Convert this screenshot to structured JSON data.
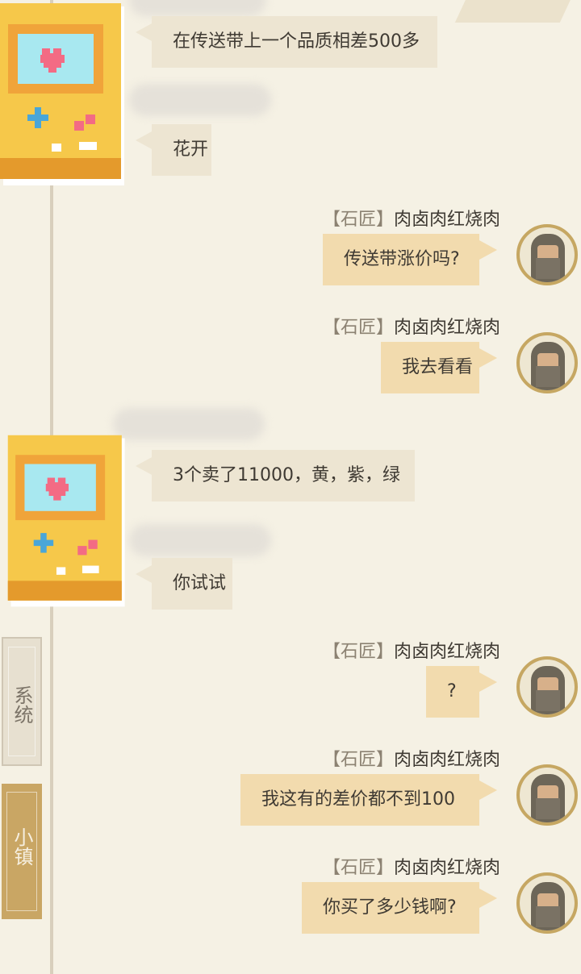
{
  "side_tabs": {
    "system": "系统",
    "town": "小镇"
  },
  "messages": [
    {
      "side": "left",
      "name_tag": "",
      "name": "",
      "text": "在传送带上一个品质相差500多"
    },
    {
      "side": "left",
      "name_tag": "",
      "name": "",
      "text": "花开"
    },
    {
      "side": "right",
      "name_tag": "【石匠】",
      "name": "肉卤肉红烧肉",
      "text": "传送带涨价吗?"
    },
    {
      "side": "right",
      "name_tag": "【石匠】",
      "name": "肉卤肉红烧肉",
      "text": "我去看看"
    },
    {
      "side": "left",
      "name_tag": "",
      "name": "",
      "text": "3个卖了11000，黄，紫，绿"
    },
    {
      "side": "left",
      "name_tag": "",
      "name": "",
      "text": "你试试"
    },
    {
      "side": "right",
      "name_tag": "【石匠】",
      "name": "肉卤肉红烧肉",
      "text": "?"
    },
    {
      "side": "right",
      "name_tag": "【石匠】",
      "name": "肉卤肉红烧肉",
      "text": "我这有的差价都不到100"
    },
    {
      "side": "right",
      "name_tag": "【石匠】",
      "name": "肉卤肉红烧肉",
      "text": "你买了多少钱啊?"
    }
  ],
  "icons": {
    "left_avatar": "gameboy-heart-icon",
    "right_avatar": "hooded-mason-avatar"
  },
  "colors": {
    "background": "#f5f1e4",
    "bubble_left": "#ede5d2",
    "bubble_right": "#f2dbae",
    "town_tab": "#c9a664"
  }
}
